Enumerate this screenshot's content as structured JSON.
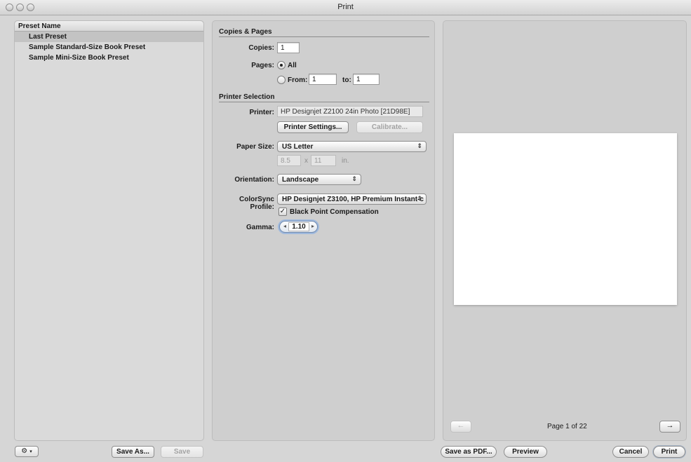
{
  "window": {
    "title": "Print"
  },
  "presets": {
    "header": "Preset Name",
    "items": [
      "Last Preset",
      "Sample Standard-Size Book Preset",
      "Sample Mini-Size Book Preset"
    ],
    "selected_index": 0,
    "save_as_label": "Save As...",
    "save_label": "Save"
  },
  "copies_pages": {
    "title": "Copies & Pages",
    "copies_label": "Copies:",
    "copies_value": "1",
    "pages_label": "Pages:",
    "all_label": "All",
    "from_label": "From:",
    "from_value": "1",
    "to_label": "to:",
    "to_value": "1"
  },
  "printer_selection": {
    "title": "Printer Selection",
    "printer_label": "Printer:",
    "printer_value": "HP Designjet Z2100 24in Photo [21D98E]",
    "printer_settings_label": "Printer Settings...",
    "calibrate_label": "Calibrate...",
    "paper_size_label": "Paper Size:",
    "paper_size_value": "US Letter",
    "paper_width": "8.5",
    "paper_x": "x",
    "paper_height": "11",
    "paper_units": "in.",
    "orientation_label": "Orientation:",
    "orientation_value": "Landscape",
    "colorsync_label": "ColorSync Profile:",
    "colorsync_value": "HP Designjet Z3100, HP Premium Instant-c",
    "bpc_label": "Black Point Compensation",
    "bpc_checked": true,
    "gamma_label": "Gamma:",
    "gamma_value": "1.10"
  },
  "preview": {
    "page_label": "Page 1 of 22",
    "prev_icon": "arrow-left",
    "next_icon": "arrow-right"
  },
  "footer": {
    "gear_icon": "gear",
    "save_pdf_label": "Save as PDF...",
    "preview_label": "Preview",
    "cancel_label": "Cancel",
    "print_label": "Print"
  }
}
